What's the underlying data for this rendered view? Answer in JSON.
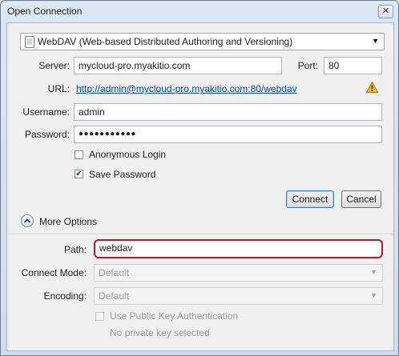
{
  "window": {
    "title": "Open Connection",
    "close_glyph": "✕"
  },
  "protocol": {
    "selected": "WebDAV (Web-based Distributed Authoring and Versioning)",
    "icon": "webdav-protocol-icon"
  },
  "server": {
    "label": "Server:",
    "value": "mycloud-pro.myakitio.com"
  },
  "port": {
    "label": "Port:",
    "value": "80"
  },
  "url": {
    "label": "URL:",
    "value": "http://admin@mycloud-pro.myakitio.com:80/webdav",
    "warning_icon": "warning-icon"
  },
  "username": {
    "label": "Username:",
    "value": "admin"
  },
  "password": {
    "label": "Password:",
    "value": "●●●●●●●●●●●"
  },
  "anonymous_login": {
    "label": "Anonymous Login",
    "checked": false
  },
  "save_password": {
    "label": "Save Password",
    "checked": true
  },
  "buttons": {
    "connect": "Connect",
    "cancel": "Cancel"
  },
  "more_options": {
    "label": "More Options",
    "expanded": true
  },
  "path": {
    "label": "Path:",
    "value": "webdav"
  },
  "connect_mode": {
    "label": "Connect Mode:",
    "value": "Default"
  },
  "encoding": {
    "label": "Encoding:",
    "value": "Default"
  },
  "public_key": {
    "label": "Use Public Key Authentication",
    "checked": false,
    "status": "No private key selected"
  },
  "colors": {
    "highlight_border": "#c8102e",
    "link": "#0645ad",
    "warning": "#f2c200"
  }
}
